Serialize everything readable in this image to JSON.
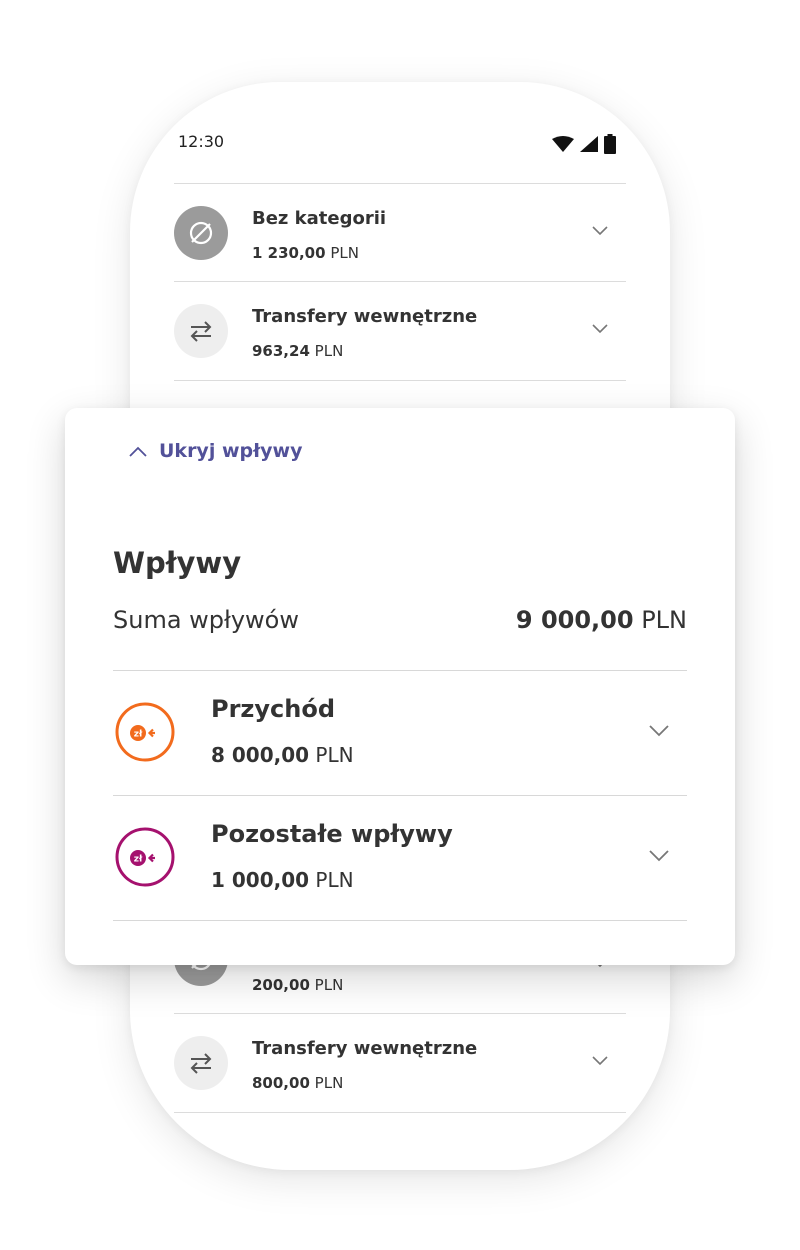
{
  "status_bar": {
    "time": "12:30"
  },
  "top_list": [
    {
      "title": "Bez kategorii",
      "amount": "1 230,00",
      "currency": "PLN",
      "icon": "no-category-icon"
    },
    {
      "title": "Transfery wewnętrzne",
      "amount": "963,24",
      "currency": "PLN",
      "icon": "transfer-arrows-icon"
    }
  ],
  "bottom_list": [
    {
      "amount": "200,00",
      "currency": "PLN",
      "icon": "no-category-icon"
    },
    {
      "title": "Transfery wewnętrzne",
      "amount": "800,00",
      "currency": "PLN",
      "icon": "transfer-arrows-icon"
    }
  ],
  "card": {
    "hide_label": "Ukryj wpływy",
    "title": "Wpływy",
    "sum_label": "Suma wpływów",
    "sum_amount": "9 000,00",
    "sum_currency": "PLN",
    "items": [
      {
        "title": "Przychód",
        "amount": "8 000,00",
        "currency": "PLN",
        "icon_text": "zł",
        "color": "#F26B1D"
      },
      {
        "title": "Pozostałe wpływy",
        "amount": "1 000,00",
        "currency": "PLN",
        "icon_text": "zł",
        "color": "#A5116E"
      }
    ]
  },
  "colors": {
    "link": "#525199",
    "gray_icon": "#9B9B9B",
    "light_icon_bg": "#EEEEEE"
  }
}
